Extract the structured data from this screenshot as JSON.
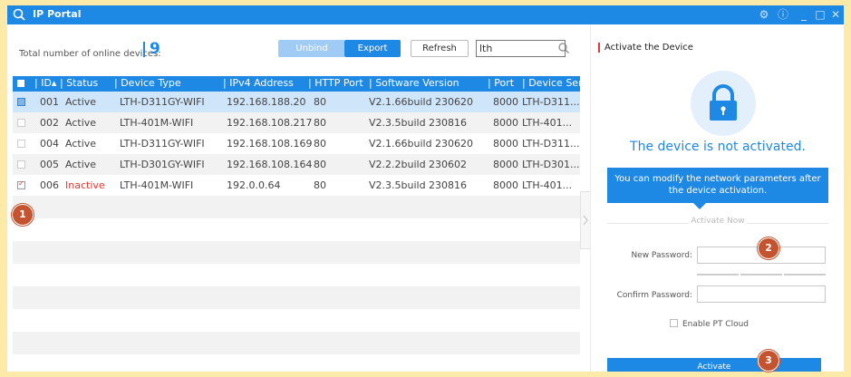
{
  "window": {
    "title": "IP Portal",
    "controls": [
      "gear-icon",
      "info-icon",
      "minimize-icon",
      "maximize-icon",
      "close-icon"
    ]
  },
  "toolbar": {
    "count_label": "Total number of online devices:",
    "count_value": "9",
    "unbind_label": "Unbind",
    "export_label": "Export",
    "refresh_label": "Refresh",
    "search_value": "lth"
  },
  "table": {
    "headers": [
      "ID",
      "Status",
      "Device Type",
      "IPv4 Address",
      "HTTP Port",
      "Software Version",
      "Port",
      "Device Ser..."
    ],
    "rows": [
      {
        "id": "001",
        "status": "Active",
        "type": "LTH-D311GY-WIFI",
        "ip": "192.168.188.20",
        "http": "80",
        "sw": "V2.1.66build 230620",
        "port": "8000",
        "serial": "LTH-D311..."
      },
      {
        "id": "002",
        "status": "Active",
        "type": "LTH-401M-WIFI",
        "ip": "192.168.108.217",
        "http": "80",
        "sw": "V2.3.5build 230816",
        "port": "8000",
        "serial": "LTH-401..."
      },
      {
        "id": "004",
        "status": "Active",
        "type": "LTH-D311GY-WIFI",
        "ip": "192.168.108.169",
        "http": "80",
        "sw": "V2.1.66build 230620",
        "port": "8000",
        "serial": "LTH-D311..."
      },
      {
        "id": "005",
        "status": "Active",
        "type": "LTH-D301GY-WIFI",
        "ip": "192.168.108.164",
        "http": "80",
        "sw": "V2.2.2build 230602",
        "port": "8000",
        "serial": "LTH-D301..."
      },
      {
        "id": "006",
        "status": "Inactive",
        "type": "LTH-401M-WIFI",
        "ip": "192.0.0.64",
        "http": "80",
        "sw": "V2.3.5build 230816",
        "port": "8000",
        "serial": "LTH-401..."
      }
    ]
  },
  "panel": {
    "title": "Activate the Device",
    "status_text": "The device is not activated.",
    "tip": "You can modify the network parameters after the device activation.",
    "activate_now": "Activate Now",
    "new_password_label": "New Password:",
    "confirm_password_label": "Confirm Password:",
    "pt_cloud_label": "Enable PT Cloud",
    "activate_button": "Activate"
  },
  "badges": [
    "1",
    "2",
    "3"
  ],
  "colors": {
    "accent": "#1e88e5",
    "inactive": "#e53935",
    "badge": "#c4532f",
    "background": "#fde9a8"
  }
}
